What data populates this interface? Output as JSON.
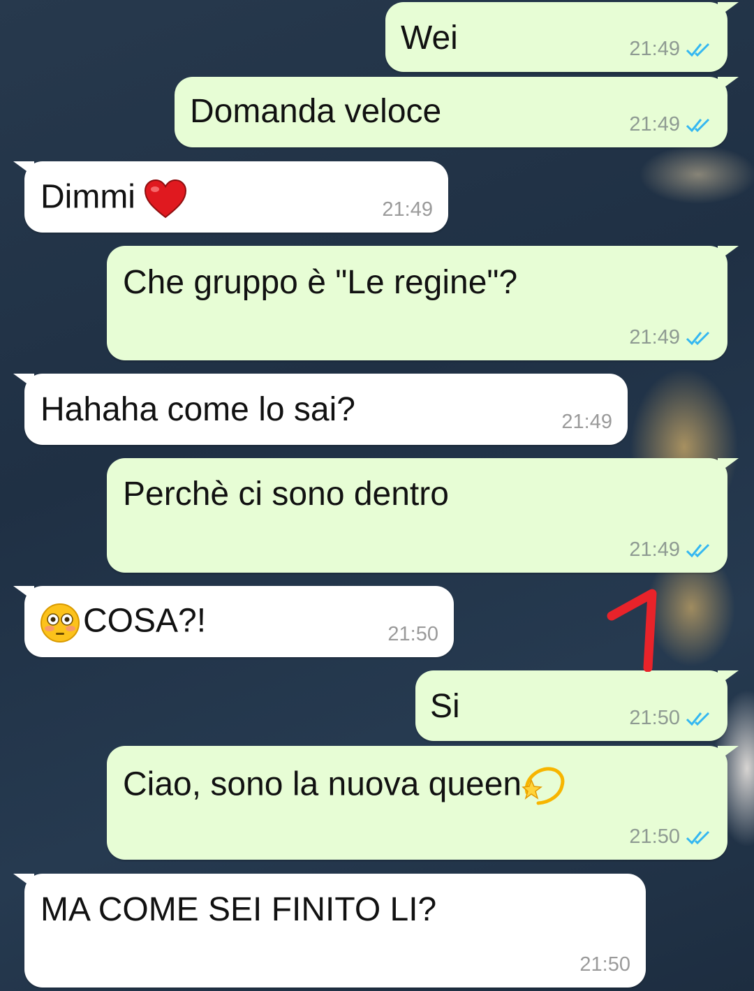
{
  "messages": [
    {
      "direction": "out",
      "text": "Wei",
      "time": "21:49",
      "status_icon": "double-check-read-icon"
    },
    {
      "direction": "out",
      "text": "Domanda veloce",
      "time": "21:49",
      "status_icon": "double-check-read-icon"
    },
    {
      "direction": "in",
      "text": "Dimmi",
      "emoji": "red-heart",
      "time": "21:49"
    },
    {
      "direction": "out",
      "text": "Che gruppo è \"Le regine\"?",
      "time": "21:49",
      "status_icon": "double-check-read-icon"
    },
    {
      "direction": "in",
      "text": "Hahaha come lo sai?",
      "time": "21:49"
    },
    {
      "direction": "out",
      "text": "Perchè ci sono dentro",
      "time": "21:49",
      "status_icon": "double-check-read-icon"
    },
    {
      "direction": "in",
      "text": "COSA?!",
      "emoji": "flushed-face",
      "time": "21:50"
    },
    {
      "direction": "out",
      "text": "Si",
      "time": "21:50",
      "status_icon": "double-check-read-icon"
    },
    {
      "direction": "out",
      "text": "Ciao, sono la nuova queen",
      "emoji": "dizzy-star",
      "time": "21:50",
      "status_icon": "double-check-read-icon"
    },
    {
      "direction": "in",
      "text": "MA COME SEI FINITO LI?",
      "time": "21:50"
    }
  ],
  "colors": {
    "outgoing_bubble": "#e7fdd5",
    "incoming_bubble": "#ffffff",
    "read_tick": "#34b7f1",
    "annotation": "#e8232a",
    "wallpaper": "#23364a"
  },
  "annotation": {
    "icon": "red-hand-drawn-mark-icon"
  }
}
